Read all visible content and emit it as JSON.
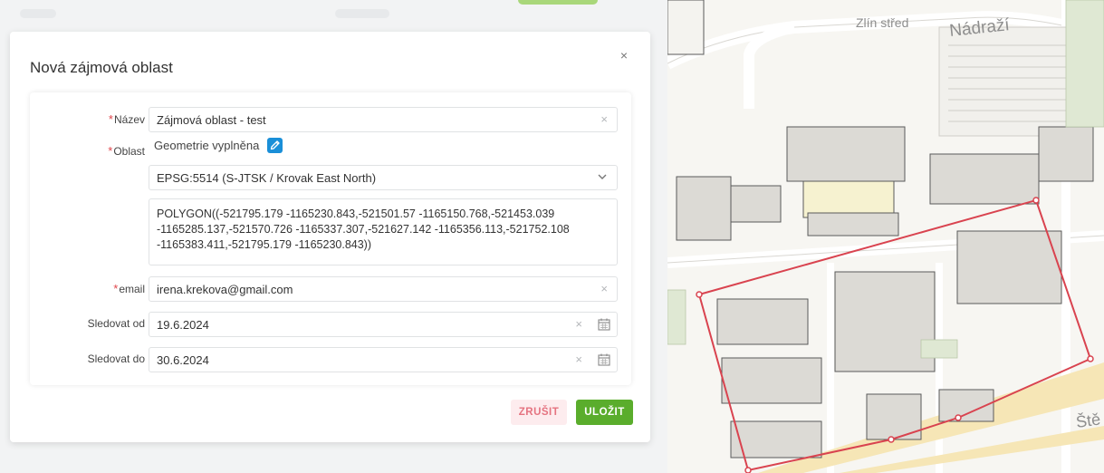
{
  "dialog": {
    "title": "Nová zájmová oblast",
    "close_icon": "close-icon"
  },
  "form": {
    "name": {
      "label": "Název",
      "required": true,
      "value": "Zájmová oblast - test"
    },
    "area": {
      "label": "Oblast",
      "required": true,
      "status": "Geometrie vyplněna",
      "crs": "EPSG:5514 (S-JTSK / Krovak East North)",
      "wkt": "POLYGON((-521795.179 -1165230.843,-521501.57 -1165150.768,-521453.039 -1165285.137,-521570.726 -1165337.307,-521627.142 -1165356.113,-521752.108 -1165383.411,-521795.179 -1165230.843))"
    },
    "email": {
      "label": "email",
      "required": true,
      "value": "irena.krekova@gmail.com"
    },
    "watch_from": {
      "label": "Sledovat od",
      "value": "19.6.2024"
    },
    "watch_to": {
      "label": "Sledovat do",
      "value": "30.6.2024"
    },
    "required_marker": "*",
    "clear_glyph": "×"
  },
  "actions": {
    "cancel_label": "ZRUŠIT",
    "save_label": "ULOŽIT"
  },
  "map": {
    "labels": {
      "district": "Zlín střed",
      "station": "Nádraží",
      "street_partial": "Ště"
    },
    "polygon_color": "#d9434f"
  },
  "colors": {
    "primary": "#5aad2c",
    "danger_text": "#e57380",
    "edit_button": "#1a8fd8",
    "required": "#e0454b"
  }
}
